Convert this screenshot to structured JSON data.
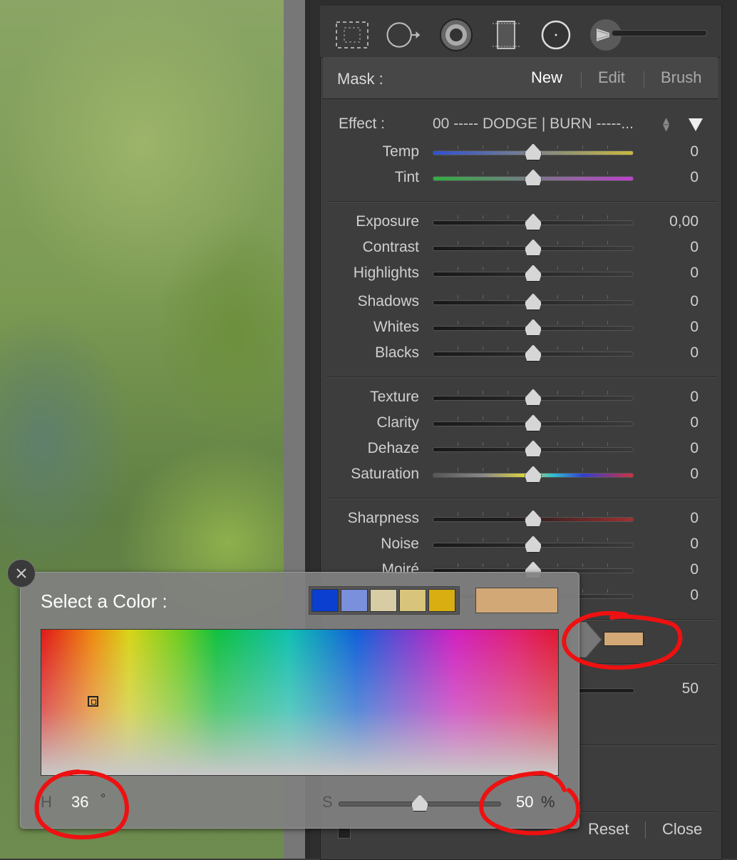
{
  "mask": {
    "label": "Mask :",
    "options": [
      "New",
      "Edit",
      "Brush"
    ],
    "active": "New"
  },
  "effect": {
    "label": "Effect :",
    "value": "00 ----- DODGE | BURN -----..."
  },
  "groups": [
    {
      "sliders": [
        {
          "label": "Temp",
          "value": "0",
          "position": 0.5,
          "track": "temp"
        },
        {
          "label": "Tint",
          "value": "0",
          "position": 0.5,
          "track": "tint"
        }
      ]
    },
    {
      "sliders": [
        {
          "label": "Exposure",
          "value": "0,00",
          "position": 0.5,
          "track": "dark"
        },
        {
          "label": "Contrast",
          "value": "0",
          "position": 0.5,
          "track": "dark"
        },
        {
          "label": "Highlights",
          "value": "0",
          "position": 0.5,
          "track": "dark"
        },
        {
          "label": "Shadows",
          "value": "0",
          "position": 0.5,
          "track": "dark"
        },
        {
          "label": "Whites",
          "value": "0",
          "position": 0.5,
          "track": "dark"
        },
        {
          "label": "Blacks",
          "value": "0",
          "position": 0.5,
          "track": "dark"
        }
      ]
    },
    {
      "sliders": [
        {
          "label": "Texture",
          "value": "0",
          "position": 0.5,
          "track": "dark"
        },
        {
          "label": "Clarity",
          "value": "0",
          "position": 0.5,
          "track": "dark"
        },
        {
          "label": "Dehaze",
          "value": "0",
          "position": 0.5,
          "track": "dark"
        },
        {
          "label": "Saturation",
          "value": "0",
          "position": 0.5,
          "track": "saturation"
        }
      ]
    },
    {
      "sliders": [
        {
          "label": "Sharpness",
          "value": "0",
          "position": 0.5,
          "track": "sharp"
        },
        {
          "label": "Noise",
          "value": "0",
          "position": 0.5,
          "track": "dark"
        },
        {
          "label": "Moiré",
          "value": "0",
          "position": 0.5,
          "track": "dark"
        },
        {
          "label": "",
          "value": "0",
          "position": 0.5,
          "track": "dark"
        }
      ]
    }
  ],
  "color_row": {
    "swatch_color": "#d2a876"
  },
  "feather": {
    "value": "50"
  },
  "footer": {
    "reset": "Reset",
    "close": "Close"
  },
  "color_picker": {
    "title": "Select a Color :",
    "presets": [
      "#0a3fd0",
      "#7a90dc",
      "#d8cca4",
      "#d8c47a",
      "#d8ae10"
    ],
    "current_color": "#d2a876",
    "hue_label": "H",
    "hue_value": "36",
    "hue_unit": "°",
    "sat_label": "S",
    "sat_value": "50",
    "sat_unit": "%",
    "sat_position": 0.5
  },
  "tools": [
    "marquee-icon",
    "spot-removal-icon",
    "red-eye-icon",
    "graduated-filter-icon",
    "radial-filter-icon",
    "adjustment-brush-icon"
  ],
  "annotation_color": "#ee1111"
}
